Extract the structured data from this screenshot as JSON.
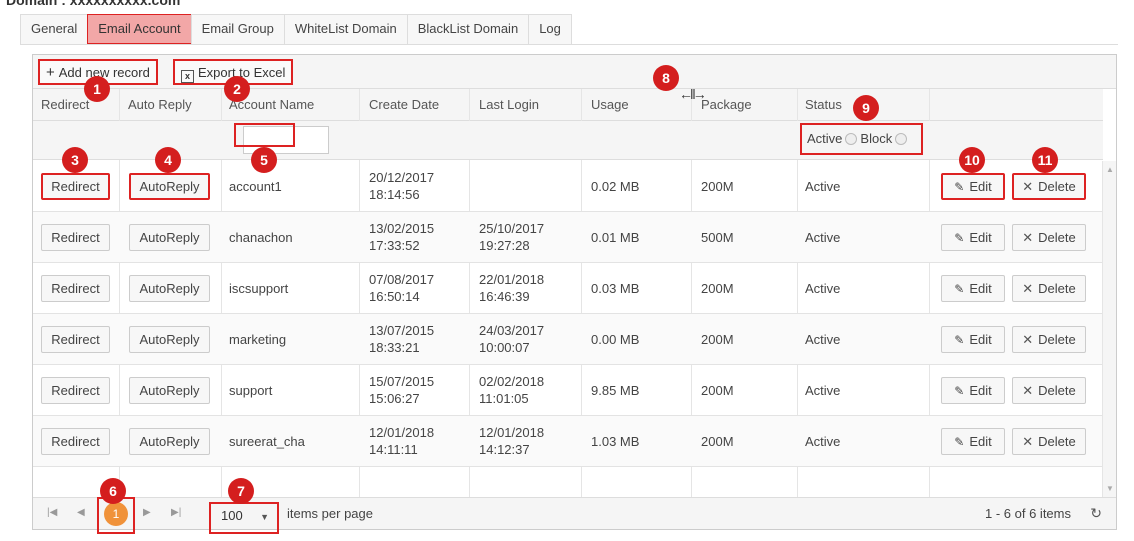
{
  "domain_title": "Domain : xxxxxxxxxx.com",
  "tabs": [
    "General",
    "Email Account",
    "Email Group",
    "WhiteList Domain",
    "BlackList Domain",
    "Log"
  ],
  "active_tab": "Email Account",
  "toolbar": {
    "add_label": "Add new record",
    "export_label": "Export to Excel"
  },
  "columns": [
    "Redirect",
    "Auto Reply",
    "Account Name",
    "Create Date",
    "Last Login",
    "Usage",
    "Package",
    "Status"
  ],
  "filter": {
    "status_active": "Active",
    "status_block": "Block"
  },
  "row_buttons": {
    "redirect": "Redirect",
    "autoreply": "AutoReply",
    "edit": "Edit",
    "delete": "Delete"
  },
  "rows": [
    {
      "account": "account1",
      "create_date": "20/12/2017",
      "create_time": "18:14:56",
      "login_date": "",
      "login_time": "",
      "usage": "0.02 MB",
      "package": "200M",
      "status": "Active"
    },
    {
      "account": "chanachon",
      "create_date": "13/02/2015",
      "create_time": "17:33:52",
      "login_date": "25/10/2017",
      "login_time": "19:27:28",
      "usage": "0.01 MB",
      "package": "500M",
      "status": "Active"
    },
    {
      "account": "iscsupport",
      "create_date": "07/08/2017",
      "create_time": "16:50:14",
      "login_date": "22/01/2018",
      "login_time": "16:46:39",
      "usage": "0.03 MB",
      "package": "200M",
      "status": "Active"
    },
    {
      "account": "marketing",
      "create_date": "13/07/2015",
      "create_time": "18:33:21",
      "login_date": "24/03/2017",
      "login_time": "10:00:07",
      "usage": "0.00 MB",
      "package": "200M",
      "status": "Active"
    },
    {
      "account": "support",
      "create_date": "15/07/2015",
      "create_time": "15:06:27",
      "login_date": "02/02/2018",
      "login_time": "11:01:05",
      "usage": "9.85 MB",
      "package": "200M",
      "status": "Active"
    },
    {
      "account": "sureerat_cha",
      "create_date": "12/01/2018",
      "create_time": "14:11:11",
      "login_date": "12/01/2018",
      "login_time": "14:12:37",
      "usage": "1.03 MB",
      "package": "200M",
      "status": "Active"
    }
  ],
  "pager": {
    "current_page": "1",
    "page_size": "100",
    "items_label": "items per page",
    "summary": "1 - 6 of 6 items"
  },
  "markers": [
    "1",
    "2",
    "3",
    "4",
    "5",
    "6",
    "7",
    "8",
    "9",
    "10",
    "11"
  ],
  "colors": {
    "highlight": "#d41e1e",
    "active_tab": "#f2a7a7",
    "current_page": "#f0923a"
  }
}
